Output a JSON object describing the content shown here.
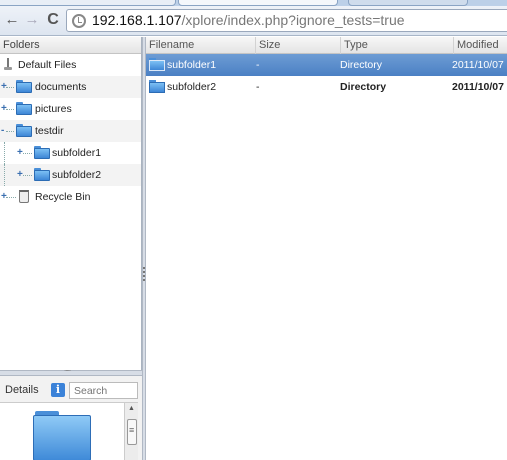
{
  "browser": {
    "url_host": "192.168.1.107",
    "url_path": "/xplore/index.php?ignore_tests=true"
  },
  "folders_panel": {
    "header": "Folders",
    "items": [
      {
        "label": "Default Files",
        "icon": "drive-icon",
        "level": 0
      },
      {
        "label": "documents",
        "icon": "folder-icon",
        "level": 0,
        "expander": "+"
      },
      {
        "label": "pictures",
        "icon": "folder-icon",
        "level": 0,
        "expander": "+"
      },
      {
        "label": "testdir",
        "icon": "folder-icon",
        "level": 0,
        "expander": "-"
      },
      {
        "label": "subfolder1",
        "icon": "folder-icon",
        "level": 1,
        "expander": "+"
      },
      {
        "label": "subfolder2",
        "icon": "folder-icon",
        "level": 1,
        "expander": "+"
      },
      {
        "label": "Recycle Bin",
        "icon": "recycle-bin-icon",
        "level": 0,
        "expander": "+"
      }
    ]
  },
  "details_panel": {
    "tab_label": "Details",
    "info_icon": "i",
    "search_placeholder": "Search"
  },
  "file_list": {
    "columns": [
      "Filename",
      "Size",
      "Type",
      "Modified"
    ],
    "rows": [
      {
        "name": "subfolder1",
        "size": "-",
        "type": "Directory",
        "modified": "2011/10/07",
        "selected": true
      },
      {
        "name": "subfolder2",
        "size": "-",
        "type": "Directory",
        "modified": "2011/10/07",
        "selected": false
      }
    ]
  },
  "colors": {
    "selection": "#5a8ccc",
    "folder": "#4a8fd8"
  }
}
